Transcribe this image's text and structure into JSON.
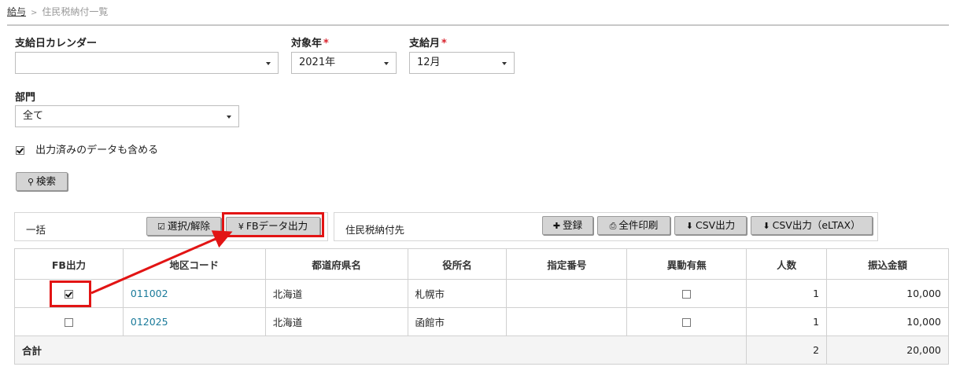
{
  "breadcrumb": {
    "parent": "給与",
    "separator": ">",
    "current": "住民税納付一覧"
  },
  "filters": {
    "calendar": {
      "label": "支給日カレンダー",
      "value": ""
    },
    "year": {
      "label": "対象年",
      "required_mark": "*",
      "value": "2021年"
    },
    "month": {
      "label": "支給月",
      "required_mark": "*",
      "value": "12月"
    },
    "department": {
      "label": "部門",
      "value": "全て"
    },
    "include_exported": {
      "label": "出力済みのデータも含める",
      "checked": true
    },
    "search_button": "検索"
  },
  "bulk_panel": {
    "title": "一括",
    "toggle_button": "選択/解除",
    "fb_button": "FBデータ出力"
  },
  "payee_panel": {
    "title": "住民税納付先",
    "register_button": "登録",
    "print_button": "全件印刷",
    "csv_button": "CSV出力",
    "csv_eltax_button": "CSV出力（eLTAX）"
  },
  "table": {
    "headers": [
      "FB出力",
      "地区コード",
      "都道府県名",
      "役所名",
      "指定番号",
      "異動有無",
      "人数",
      "振込金額"
    ],
    "rows": [
      {
        "fb_checked": true,
        "code": "011002",
        "prefecture": "北海道",
        "office": "札幌市",
        "designation": "",
        "changed": false,
        "count": "1",
        "amount": "10,000"
      },
      {
        "fb_checked": false,
        "code": "012025",
        "prefecture": "北海道",
        "office": "函館市",
        "designation": "",
        "changed": false,
        "count": "1",
        "amount": "10,000"
      }
    ],
    "total": {
      "label": "合計",
      "count": "2",
      "amount": "20,000"
    }
  },
  "colors": {
    "highlight": "#e21414",
    "link": "#1a7a9a",
    "button_bg": "#d4d4d4"
  },
  "icons": {
    "search": "magnifier-icon",
    "toggle": "checkbox-edit-icon",
    "fb": "yen-icon",
    "register": "plus-icon",
    "print": "printer-icon",
    "csv": "download-icon"
  }
}
